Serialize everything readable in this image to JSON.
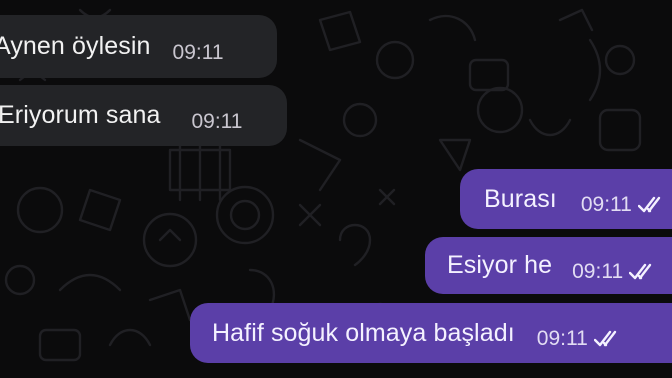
{
  "chat": {
    "messages": [
      {
        "direction": "incoming",
        "text": "Aynen öylesin",
        "time": "09:11"
      },
      {
        "direction": "incoming",
        "text": "Eriyorum sana",
        "time": "09:11"
      },
      {
        "direction": "outgoing",
        "text": "Burası",
        "time": "09:11",
        "status_icon": "double-check-icon"
      },
      {
        "direction": "outgoing",
        "text": "Esiyor he",
        "time": "09:11",
        "status_icon": "double-check-icon"
      },
      {
        "direction": "outgoing",
        "text": "Hafif soğuk olmaya başladı",
        "time": "09:11",
        "status_icon": "double-check-icon"
      }
    ]
  },
  "colors": {
    "background": "#0b0b0c",
    "incoming_bubble": "#232427",
    "outgoing_bubble": "#5b3fa8",
    "text": "#f2f2f2"
  }
}
